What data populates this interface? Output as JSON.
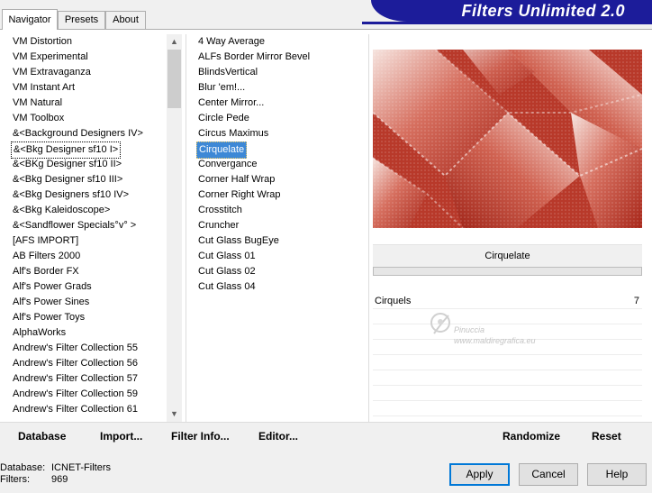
{
  "tabs": [
    {
      "label": "Navigator"
    },
    {
      "label": "Presets"
    },
    {
      "label": "About"
    }
  ],
  "title": "Filters Unlimited 2.0",
  "categories": [
    "VM Distortion",
    "VM Experimental",
    "VM Extravaganza",
    "VM Instant Art",
    "VM Natural",
    "VM Toolbox",
    "&<Background Designers IV>",
    "&<Bkg Designer sf10 I>",
    "&<BKg Designer sf10 II>",
    "&<Bkg Designer sf10 III>",
    "&<Bkg Designers sf10 IV>",
    "&<Bkg Kaleidoscope>",
    "&<Sandflower Specials°v° >",
    "[AFS IMPORT]",
    "AB Filters 2000",
    "Alf's Border FX",
    "Alf's Power Grads",
    "Alf's Power Sines",
    "Alf's Power Toys",
    "AlphaWorks",
    "Andrew's Filter Collection 55",
    "Andrew's Filter Collection 56",
    "Andrew's Filter Collection 57",
    "Andrew's Filter Collection 59",
    "Andrew's Filter Collection 61"
  ],
  "category_focused_index": 7,
  "filters": [
    "4 Way Average",
    "ALFs Border Mirror Bevel",
    "BlindsVertical",
    "Blur 'em!...",
    "Center Mirror...",
    "Circle Pede",
    "Circus Maximus",
    "Cirquelate",
    "Convergance",
    "Corner Half Wrap",
    "Corner Right Wrap",
    "Crosstitch",
    "Cruncher",
    "Cut Glass  BugEye",
    "Cut Glass 01",
    "Cut Glass 02",
    "Cut Glass 04"
  ],
  "filter_selected_index": 7,
  "selected_filter_name": "Cirquelate",
  "params": [
    {
      "label": "Cirquels",
      "value": "7"
    }
  ],
  "watermark": {
    "line1": "Pinuccia",
    "line2": "www.maldiregrafica.eu"
  },
  "bottom_bar": {
    "database": "Database",
    "import": "Import...",
    "filter_info": "Filter Info...",
    "editor": "Editor...",
    "randomize": "Randomize",
    "reset": "Reset"
  },
  "status": {
    "database_label": "Database:",
    "database_value": "ICNET-Filters",
    "filters_label": "Filters:",
    "filters_value": "969"
  },
  "buttons": {
    "apply": "Apply",
    "cancel": "Cancel",
    "help": "Help"
  },
  "colors": {
    "title_bar": "#1c1c9a",
    "selection": "#3d88d6",
    "preview_red": "#c04634"
  }
}
